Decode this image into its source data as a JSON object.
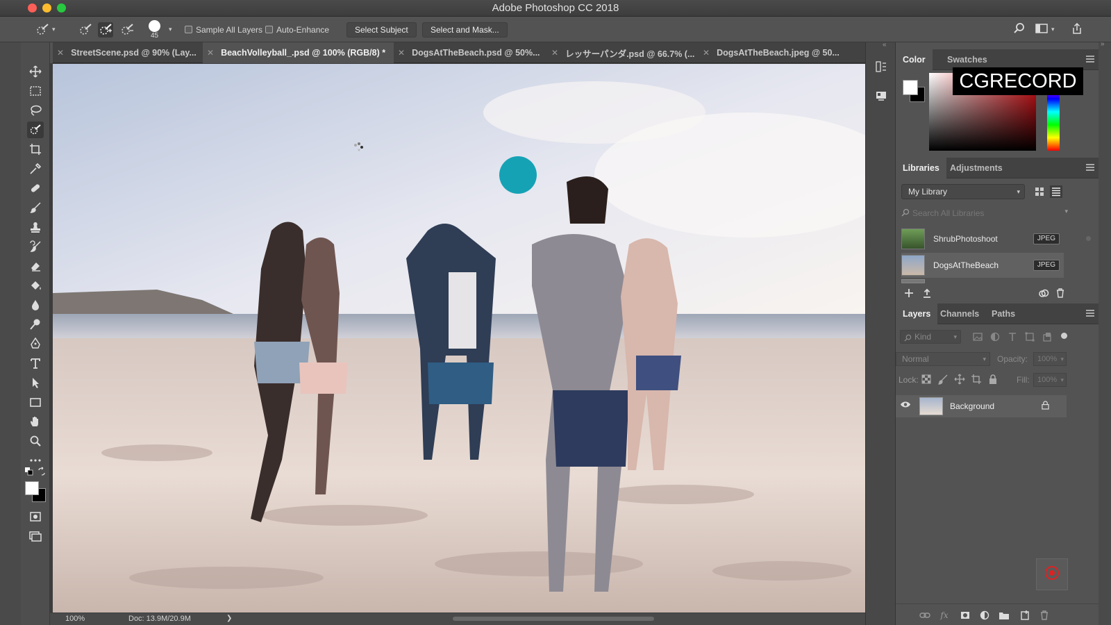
{
  "window": {
    "title": "Adobe Photoshop CC 2018"
  },
  "options_bar": {
    "brush_size": "45",
    "sample_all_layers": "Sample All Layers",
    "auto_enhance": "Auto-Enhance",
    "select_subject": "Select Subject",
    "select_and_mask": "Select and Mask..."
  },
  "doc_tabs": [
    {
      "label": "StreetScene.psd @ 90% (Lay..."
    },
    {
      "label": "BeachVolleyball_.psd @ 100% (RGB/8) *"
    },
    {
      "label": "DogsAtTheBeach.psd @ 50%..."
    },
    {
      "label": "レッサーパンダ.psd @ 66.7% (..."
    },
    {
      "label": "DogsAtTheBeach.jpeg @ 50..."
    }
  ],
  "status": {
    "zoom": "100%",
    "doc": "Doc: 13.9M/20.9M",
    "arrow": "❯"
  },
  "color_panel": {
    "tab_color": "Color",
    "tab_swatches": "Swatches",
    "watermark": "CGRECORD"
  },
  "libraries_panel": {
    "tab_libraries": "Libraries",
    "tab_adjustments": "Adjustments",
    "library_select": "My Library",
    "search_placeholder": "Search All Libraries",
    "items": [
      {
        "name": "ShrubPhotoshoot",
        "type": "JPEG"
      },
      {
        "name": "DogsAtTheBeach",
        "type": "JPEG"
      }
    ]
  },
  "layers_panel": {
    "tab_layers": "Layers",
    "tab_channels": "Channels",
    "tab_paths": "Paths",
    "filter_kind": "Kind",
    "blend_mode": "Normal",
    "opacity_label": "Opacity:",
    "opacity_value": "100%",
    "lock_label": "Lock:",
    "fill_label": "Fill:",
    "fill_value": "100%",
    "layers": [
      {
        "name": "Background"
      }
    ]
  },
  "colors": {
    "bg": "#535353",
    "panel_dark": "#424242",
    "accent": "#2d7fd6"
  }
}
